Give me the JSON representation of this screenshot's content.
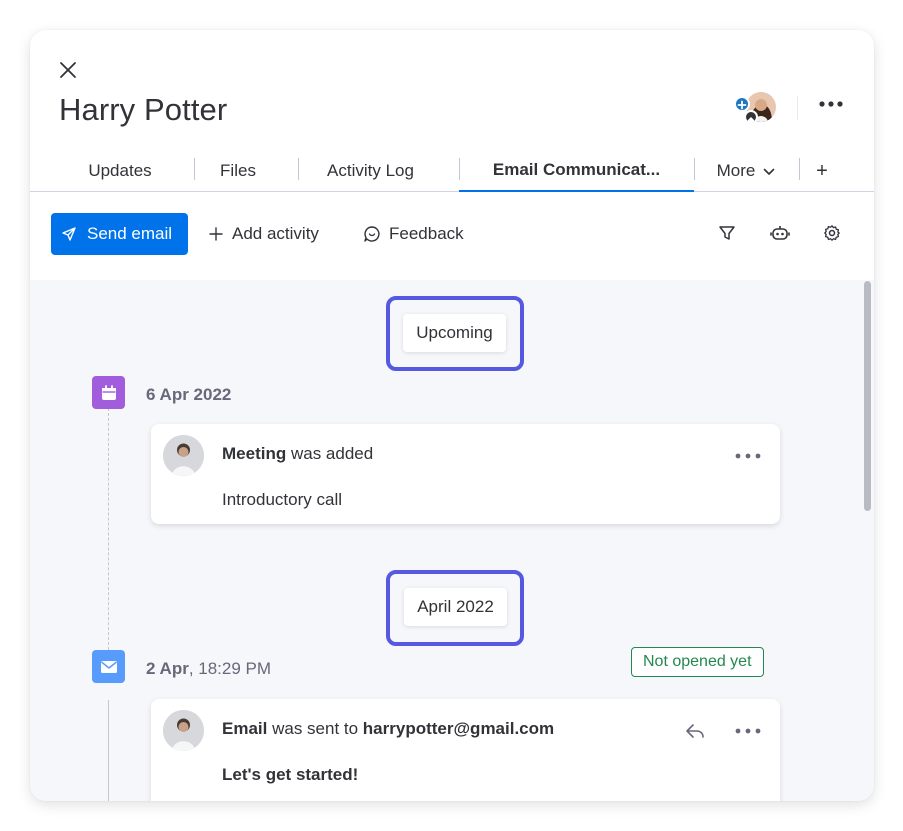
{
  "header": {
    "title": "Harry Potter"
  },
  "tabs": [
    {
      "label": "Updates"
    },
    {
      "label": "Files"
    },
    {
      "label": "Activity Log"
    },
    {
      "label": "Email Communicat..."
    },
    {
      "label": "More"
    },
    {
      "label": "+"
    }
  ],
  "active_tab": "Email Communicat...",
  "toolbar": {
    "send_email": "Send email",
    "add_activity": "Add activity",
    "feedback": "Feedback"
  },
  "feed": {
    "groups": [
      {
        "label": "Upcoming",
        "entry": {
          "type_icon": "calendar-icon",
          "date_bold": "6 Apr 2022",
          "date_rest": "",
          "card": {
            "kind": "Meeting",
            "action": " was added",
            "body": "Introductory call"
          }
        }
      },
      {
        "label": "April 2022",
        "entry": {
          "type_icon": "envelope-icon",
          "date_bold": "2 Apr",
          "date_rest": ", 18:29 PM",
          "status": "Not opened yet",
          "card": {
            "kind": "Email",
            "action": " was sent to ",
            "recipient": "harrypotter@gmail.com",
            "body": "Let's get started!"
          }
        }
      }
    ]
  },
  "colors": {
    "primary": "#0073ea",
    "highlight": "#5559df",
    "meeting_icon_bg": "#a25ddc",
    "email_icon_bg": "#579bfc",
    "status_green": "#258750"
  }
}
